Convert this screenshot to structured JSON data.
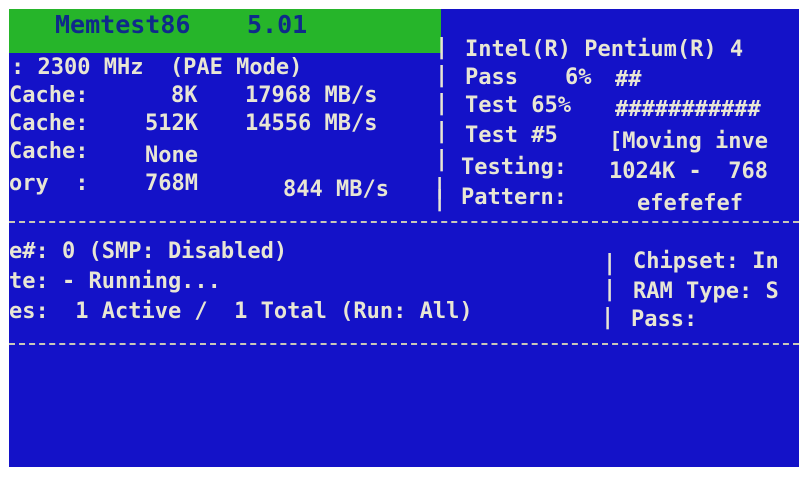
{
  "banner": {
    "title": "Memtest86",
    "version": "5.01"
  },
  "left_info": {
    "clk": ": 2300 MHz  (PAE Mode)",
    "l1_label": "Cache:",
    "l1_size": "8K",
    "l1_speed": "17968 MB/s",
    "l2_label": "Cache:",
    "l2_size": "512K",
    "l2_speed": "14556 MB/s",
    "l3_label": "Cache:",
    "l3_size": "None",
    "mem_label": "ory  :",
    "mem_size": "768M",
    "mem_speed": "844 MB/s"
  },
  "right_info": {
    "cpu": "Intel(R) Pentium(R) 4",
    "pass_label": "Pass",
    "pass_pct": "6%",
    "pass_bar": "##",
    "test_label": "Test 65%",
    "test_bar": "###########",
    "testnum_label": "Test #5",
    "testnum_desc": "[Moving inve",
    "testing_label": "Testing:",
    "testing_range": "1024K -  768",
    "pattern_label": "Pattern:",
    "pattern_value": "efefefef"
  },
  "separator": "|",
  "status": {
    "core": "e#: 0 (SMP: Disabled)",
    "state": "te: - Running...",
    "cores": "es:  1 Active /  1 Total (Run: All)",
    "chipset": "Chipset: In",
    "ram_type": "RAM Type: S",
    "pass": "Pass:"
  },
  "colors": {
    "screen_bg": "#1412c8",
    "banner_bg": "#26b52a",
    "text": "#e8e6d4"
  }
}
